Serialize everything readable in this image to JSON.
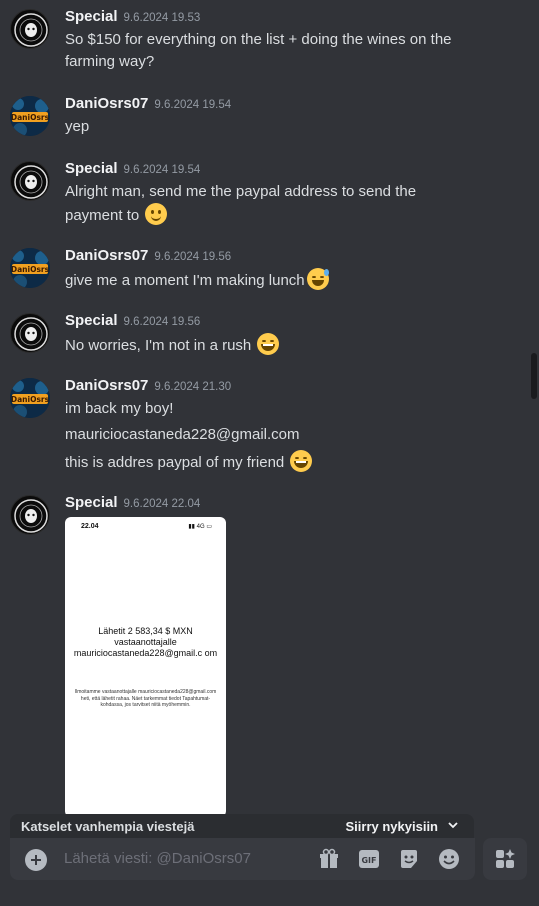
{
  "messages": [
    {
      "author": "Special",
      "timestamp": "9.6.2024 19.53",
      "lines": [
        "So $150 for everything on the list + doing the wines on the",
        "farming way?"
      ]
    },
    {
      "author": "DaniOsrs07",
      "timestamp": "9.6.2024 19.54",
      "lines": [
        "yep"
      ]
    },
    {
      "author": "Special",
      "timestamp": "9.6.2024 19.54",
      "lines": [
        "Alright man, send me the paypal address to send the",
        "payment to"
      ]
    },
    {
      "author": "DaniOsrs07",
      "timestamp": "9.6.2024 19.56",
      "lines": [
        "give me a moment I'm making lunch"
      ]
    },
    {
      "author": "Special",
      "timestamp": "9.6.2024 19.56",
      "lines": [
        "No worries, I'm not in a rush"
      ]
    },
    {
      "author": "DaniOsrs07",
      "timestamp": "9.6.2024 21.30",
      "lines": [
        "im back my boy!",
        "mauriciocastaneda228@gmail.com",
        "this is  addres paypal of my friend"
      ]
    },
    {
      "author": "Special",
      "timestamp": "9.6.2024 22.04",
      "lines": []
    }
  ],
  "attachment": {
    "status_time": "22.04",
    "status_right": "4G",
    "main_text": "Lähetit 2 583,34 $ MXN vastaanottajalle mauriciocastaneda228@gmail.c om",
    "sub_text": "Ilmoitamme vastaanottajalle mauriciocastaneda228@gmail.com heti, että lähetit rahaa. Näet tarkemmat tiedot Tapahtumat-kohdassa, jos tarvitset niitä myöhemmin."
  },
  "older_bar": {
    "label": "Katselet vanhempia viestejä",
    "jump": "Siirry nykyisiin"
  },
  "composer": {
    "placeholder": "Lähetä viesti: @DaniOsrs07"
  },
  "colors": {
    "background": "#313338",
    "composer": "#383a40",
    "emoji": "#ffcc4d"
  },
  "icons": [
    "plus-icon",
    "gift-icon",
    "gif-icon",
    "sticker-icon",
    "emoji-icon",
    "apps-icon",
    "chevron-down-icon"
  ]
}
